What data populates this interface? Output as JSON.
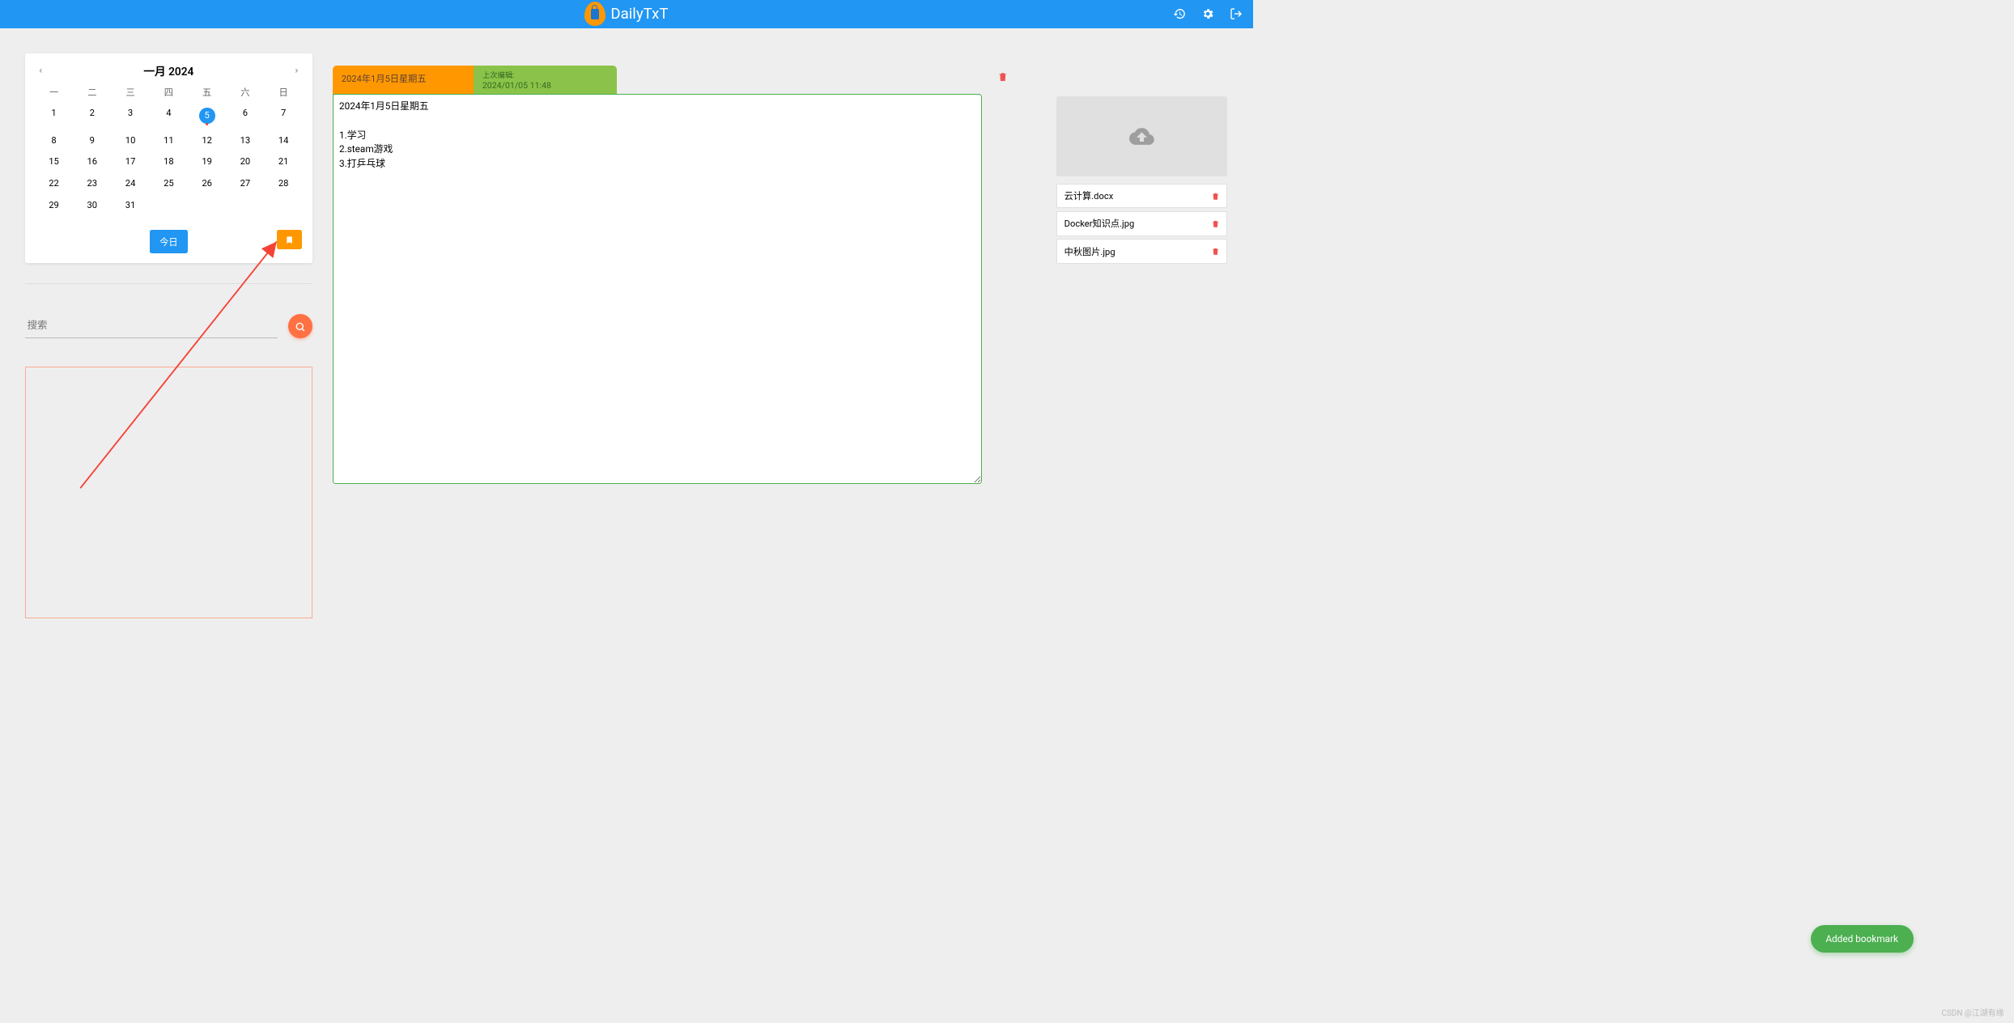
{
  "header": {
    "title": "DailyTxT"
  },
  "calendar": {
    "month_label": "一月 2024",
    "dow": [
      "一",
      "二",
      "三",
      "四",
      "五",
      "六",
      "日"
    ],
    "weeks": [
      [
        1,
        2,
        3,
        4,
        5,
        6,
        7
      ],
      [
        8,
        9,
        10,
        11,
        12,
        13,
        14
      ],
      [
        15,
        16,
        17,
        18,
        19,
        20,
        21
      ],
      [
        22,
        23,
        24,
        25,
        26,
        27,
        28
      ],
      [
        29,
        30,
        31,
        null,
        null,
        null,
        null
      ]
    ],
    "selected_day": 5,
    "today_label": "今日"
  },
  "search": {
    "placeholder": "搜索"
  },
  "entry": {
    "date_header": "2024年1月5日星期五",
    "last_edit_label": "上次编辑:",
    "last_edit_time": "2024/01/05 11:48",
    "body": "2024年1月5日星期五\n\n1.学习\n2.steam游戏\n3.打乒乓球"
  },
  "files": {
    "items": [
      {
        "name": "云计算.docx"
      },
      {
        "name": "Docker知识点.jpg"
      },
      {
        "name": "中秋图片.jpg"
      }
    ]
  },
  "toast": {
    "message": "Added bookmark"
  },
  "watermark": "CSDN @江湖有缘"
}
